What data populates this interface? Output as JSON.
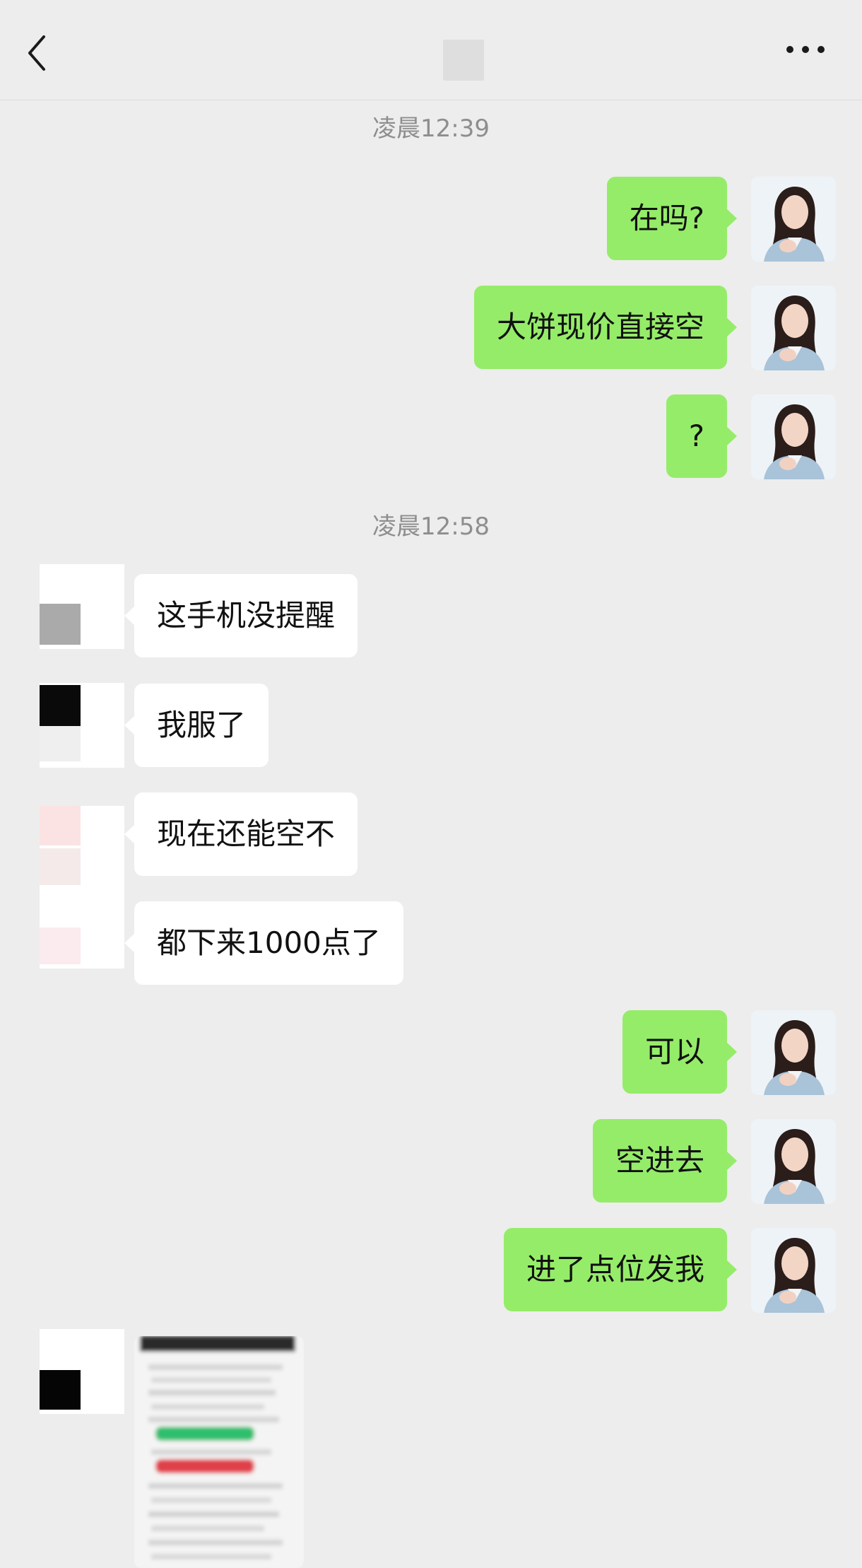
{
  "header": {
    "back_icon": "chevron-left-icon",
    "more_icon": "ellipsis-icon"
  },
  "time_separators": [
    "凌晨12:39",
    "凌晨12:58"
  ],
  "messages": [
    {
      "side": "out",
      "text": "在吗?"
    },
    {
      "side": "out",
      "text": "大饼现价直接空"
    },
    {
      "side": "out",
      "text": "?"
    },
    {
      "side": "in",
      "text": "这手机没提醒"
    },
    {
      "side": "in",
      "text": "我服了"
    },
    {
      "side": "in",
      "text": "现在还能空不"
    },
    {
      "side": "in",
      "text": "都下来1000点了"
    },
    {
      "side": "out",
      "text": "可以"
    },
    {
      "side": "out",
      "text": "空进去"
    },
    {
      "side": "out",
      "text": "进了点位发我"
    }
  ],
  "colors": {
    "background": "#ededed",
    "outgoing_bubble": "#95ec69",
    "incoming_bubble": "#ffffff",
    "time_text": "#8e8e8e"
  }
}
